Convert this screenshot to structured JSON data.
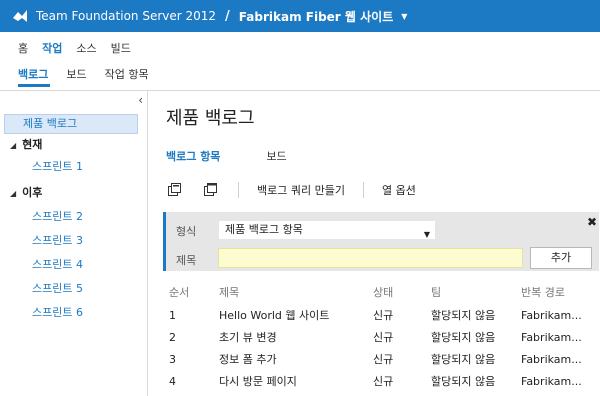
{
  "header": {
    "server": "Team Foundation Server 2012",
    "separator": "/",
    "project": "Fabrikam Fiber 웹 사이트",
    "caret_icon": "chevron-down-icon",
    "accent": "#1c79c4"
  },
  "nav_primary": [
    {
      "label": "홈"
    },
    {
      "label": "작업"
    },
    {
      "label": "소스"
    },
    {
      "label": "빌드"
    }
  ],
  "nav_secondary": [
    {
      "label": "백로그"
    },
    {
      "label": "보드"
    },
    {
      "label": "작업 항목"
    }
  ],
  "sidebar": {
    "product_backlog": "제품 백로그",
    "current_label": "현재",
    "current_sprints": [
      {
        "label": "스프린트 1"
      }
    ],
    "future_label": "이후",
    "future_sprints": [
      {
        "label": "스프린트 2"
      },
      {
        "label": "스프린트 3"
      },
      {
        "label": "스프린트 4"
      },
      {
        "label": "스프린트 5"
      },
      {
        "label": "스프린트 6"
      }
    ]
  },
  "main": {
    "title": "제품 백로그",
    "tabs": [
      {
        "label": "백로그 항목"
      },
      {
        "label": "보드"
      }
    ],
    "toolbar": {
      "create_query": "백로그 쿼리 만들기",
      "column_options": "열 옵션"
    },
    "filter": {
      "type_label": "형식",
      "type_value": "제품 백로그 항목",
      "title_label": "제목",
      "title_value": "",
      "add_button": "추가"
    },
    "table": {
      "columns": [
        "순서",
        "제목",
        "상태",
        "팀",
        "반복 경로"
      ],
      "rows": [
        [
          "1",
          "Hello World 웹 사이트",
          "신규",
          "할당되지 않음",
          "Fabrikam..."
        ],
        [
          "2",
          "초기 뷰 변경",
          "신규",
          "할당되지 않음",
          "Fabrikam..."
        ],
        [
          "3",
          "정보 폼 추가",
          "신규",
          "할당되지 않음",
          "Fabrikam..."
        ],
        [
          "4",
          "다시 방문 페이지",
          "신규",
          "할당되지 않음",
          "Fabrikam..."
        ]
      ]
    }
  }
}
